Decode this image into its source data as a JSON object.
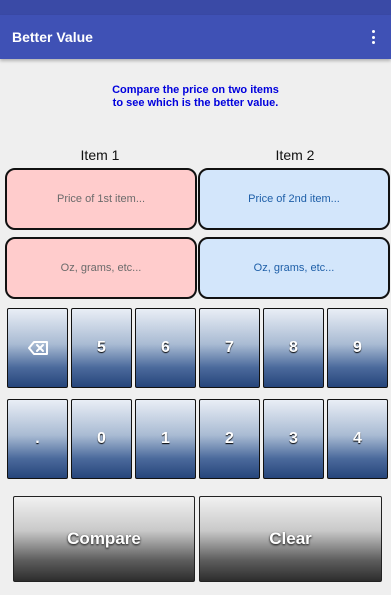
{
  "app_bar": {
    "title": "Better Value"
  },
  "instructions": {
    "line1": "Compare the price on two items",
    "line2": "to see which is the better value."
  },
  "columns": {
    "item1": "Item 1",
    "item2": "Item 2"
  },
  "fields": {
    "price1_placeholder": "Price of 1st item...",
    "price2_placeholder": "Price of 2nd item...",
    "unit1_placeholder": "Oz, grams, etc...",
    "unit2_placeholder": "Oz, grams, etc..."
  },
  "keypad": {
    "row1": [
      "backspace-icon",
      "5",
      "6",
      "7",
      "8",
      "9"
    ],
    "row2": [
      ".",
      "0",
      "1",
      "2",
      "3",
      "4"
    ]
  },
  "actions": {
    "compare": "Compare",
    "clear": "Clear"
  },
  "colors": {
    "app_bar": "#3f51b5",
    "instruction_text": "#0000dd",
    "item1_field": "#ffcccc",
    "item2_field": "#d3e6fb",
    "key_gradient_bottom": "#26457b"
  }
}
